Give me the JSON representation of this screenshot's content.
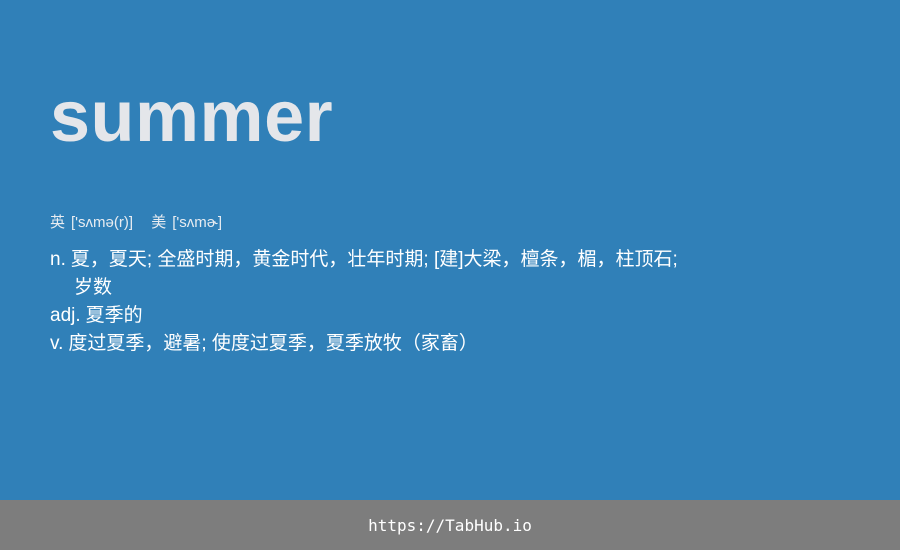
{
  "entry": {
    "word": "summer",
    "phonetics": {
      "uk_label": "英",
      "uk_ipa": "['sʌmə(r)]",
      "us_label": "美",
      "us_ipa": "['sʌmɚ]"
    },
    "definitions": {
      "noun_pos": "n.",
      "noun_line1": "夏，夏天; 全盛时期，黄金时代，壮年时期; [建]大梁，檀条，楣，柱顶石;",
      "noun_line2": "岁数",
      "adj_pos": "adj.",
      "adj_text": "夏季的",
      "verb_pos": "v.",
      "verb_text": "度过夏季，避暑; 使度过夏季，夏季放牧（家畜）"
    }
  },
  "footer": {
    "url": "https://TabHub.io"
  },
  "colors": {
    "background": "#3080b8",
    "footer_background": "#7d7d7d",
    "word_text": "#e4e6ea",
    "body_text": "#ffffff"
  }
}
